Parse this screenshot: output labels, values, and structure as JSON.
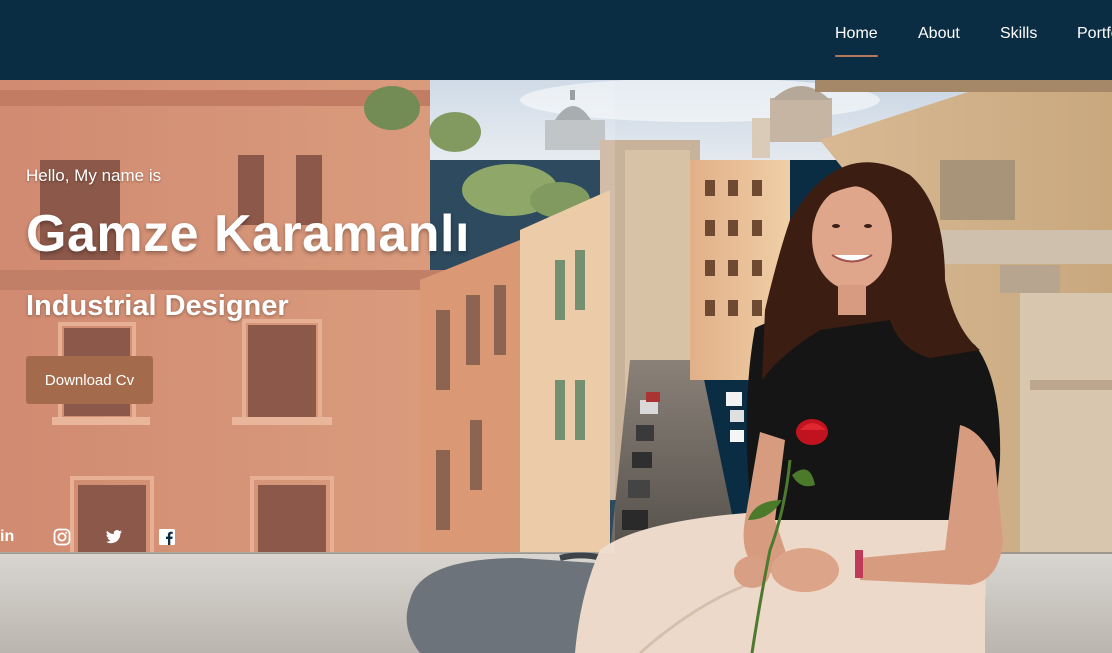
{
  "nav": {
    "items": [
      {
        "label": "Home",
        "active": true
      },
      {
        "label": "About",
        "active": false
      },
      {
        "label": "Skills",
        "active": false
      },
      {
        "label": "Portfolio",
        "active": false
      }
    ]
  },
  "hero": {
    "greeting": "Hello, My name is",
    "name": "Gamze Karamanlı",
    "role": "Industrial Designer",
    "cta_label": "Download Cv",
    "background": "photo of a woman holding a red rose on the Spanish Steps overlooking Via Condotti in Rome",
    "social": [
      {
        "icon": "linkedin-icon",
        "glyph": "in"
      },
      {
        "icon": "instagram-icon"
      },
      {
        "icon": "twitter-icon"
      },
      {
        "icon": "facebook-icon"
      }
    ]
  },
  "colors": {
    "navbar_bg": "#0b2d44",
    "accent": "#a46a4c",
    "nav_underline": "#b0775a",
    "text": "#ffffff"
  }
}
